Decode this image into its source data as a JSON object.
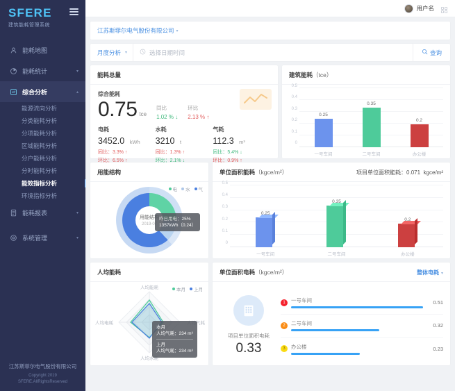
{
  "sidebar": {
    "logo": "SFERE",
    "subtitle": "建筑能耗管理系统",
    "menu": [
      {
        "label": "能耗地图",
        "icon": "map-icon",
        "expandable": false
      },
      {
        "label": "能耗统计",
        "icon": "pie-icon",
        "expandable": true
      },
      {
        "label": "综合分析",
        "icon": "analysis-icon",
        "expandable": true,
        "active": true
      }
    ],
    "submenu": [
      {
        "label": "能源流向分析"
      },
      {
        "label": "分类能耗分析"
      },
      {
        "label": "分项能耗分析"
      },
      {
        "label": "区域能耗分析"
      },
      {
        "label": "分户能耗分析"
      },
      {
        "label": "分时能耗分析"
      },
      {
        "label": "能效指标分析",
        "selected": true
      },
      {
        "label": "环境指标分析"
      }
    ],
    "menu_bottom": [
      {
        "label": "能耗报表",
        "icon": "report-icon",
        "expandable": true
      },
      {
        "label": "系统管理",
        "icon": "gear-icon",
        "expandable": true
      }
    ],
    "footer": {
      "company": "江苏斯菲尔电气股份有限公司",
      "copyright": "Copyright 2019",
      "rights": "SFERE.AllRightsReserved"
    }
  },
  "topbar": {
    "user_name": "用户名"
  },
  "org": {
    "name": "江苏斯菲尔电气股份有限公司"
  },
  "filter": {
    "period": "月度分析",
    "date_placeholder": "选择日期时间",
    "search_label": "查询"
  },
  "summary": {
    "title": "能耗总量",
    "comprehensive_label": "综合能耗",
    "value": "0.75",
    "unit": "tce",
    "yoy_label": "同比",
    "yoy_value": "1.02 %",
    "yoy_dir": "down",
    "mom_label": "环比",
    "mom_value": "2.13 %",
    "mom_dir": "up",
    "metrics": [
      {
        "name": "电耗",
        "value": "3452.0",
        "unit": "kWh",
        "yoy": "同比：3.3%",
        "yoy_dir": "up",
        "mom": "环比：6.5%",
        "mom_dir": "up"
      },
      {
        "name": "水耗",
        "value": "3210",
        "unit": "t",
        "yoy": "同比：1.3%",
        "yoy_dir": "up",
        "mom": "环比：2.1%",
        "mom_dir": "down"
      },
      {
        "name": "气耗",
        "value": "112.3",
        "unit": "m³",
        "yoy": "同比：5.4%",
        "yoy_dir": "down",
        "mom": "环比：0.9%",
        "mom_dir": "up"
      }
    ]
  },
  "building_card": {
    "title": "建筑能耗",
    "unit": "（tce）"
  },
  "structure_card": {
    "title": "用能结构",
    "legend": [
      {
        "label": "电",
        "color": "#4ecb9a"
      },
      {
        "label": "水",
        "color": "#aec7e8"
      },
      {
        "label": "气",
        "color": "#4a7fe0"
      }
    ],
    "center_title": "用能结构",
    "center_date": "2019-07",
    "tooltip": {
      "line1": "昨日用电：",
      "percent": "25%",
      "line2": "1357kWh（0.24）"
    }
  },
  "unit_area_card": {
    "title": "单位面积能耗",
    "unit": "（kgce/m²）",
    "project_label": "项目单位面积能耗：",
    "project_value": "0.071",
    "project_unit": "kgce/m²"
  },
  "per_capita_card": {
    "title": "人均能耗",
    "legend": [
      {
        "label": "本月",
        "color": "#4ecb9a"
      },
      {
        "label": "上月",
        "color": "#4a7fe0"
      }
    ],
    "axes": [
      "人均能耗",
      "人均气耗",
      "人均水耗",
      "人均电耗"
    ],
    "tooltip": {
      "g1_title": "本月",
      "g1_row": "人均气耗：234 m³",
      "g2_title": "上月",
      "g2_row": "人均气耗：234 m³"
    }
  },
  "elec_rank_card": {
    "title": "单位面积电耗",
    "unit": "（kgce/m²）",
    "selector": "整体电耗",
    "project_label": "项目单位面积电耗",
    "project_value": "0.33",
    "rows": [
      {
        "rank": "1",
        "name": "一号车间",
        "value": "0.51",
        "pct": 100,
        "color": "#f5222d"
      },
      {
        "rank": "2",
        "name": "二号车间",
        "value": "0.32",
        "pct": 67,
        "color": "#fa8c16"
      },
      {
        "rank": "3",
        "name": "办公楼",
        "value": "0.23",
        "pct": 52,
        "color": "#fadb14"
      }
    ]
  },
  "chart_data": [
    {
      "type": "bar",
      "title": "建筑能耗 (tce)",
      "categories": [
        "一号车间",
        "二号车间",
        "办公楼"
      ],
      "values": [
        0.25,
        0.35,
        0.2
      ],
      "colors": [
        "#6c93ed",
        "#4ecb9a",
        "#cc4040"
      ],
      "ylabel": "tce",
      "ylim": [
        0,
        0.5
      ],
      "yticks": [
        0,
        0.1,
        0.2,
        0.3,
        0.4,
        0.5
      ],
      "ytick_labels": [
        "0",
        "0.1",
        "0.2",
        "0.3",
        "0.4",
        "0.5"
      ],
      "data_labels": [
        "0.25",
        "0.35",
        "0.2"
      ],
      "grid": true,
      "legend": false
    },
    {
      "type": "bar",
      "title": "单位面积能耗 (kgce/m²)",
      "categories": [
        "一号车间",
        "二号车间",
        "办公楼"
      ],
      "values": [
        0.25,
        0.35,
        0.2
      ],
      "colors": [
        "#6c93ed",
        "#4ecb9a",
        "#cc4040"
      ],
      "ylabel": "kgce/m²",
      "ylim": [
        0,
        0.5
      ],
      "yticks": [
        0,
        0.1,
        0.2,
        0.3,
        0.4,
        0.5
      ],
      "ytick_labels": [
        "0",
        "0.1",
        "0.2",
        "0.3",
        "0.4",
        "0.5"
      ],
      "data_labels": [
        "0.25",
        "0.35",
        "0.2"
      ],
      "grid": true,
      "legend": false,
      "annotation": "项目单位面积能耗：0.071 kgce/m²"
    },
    {
      "type": "pie",
      "title": "用能结构",
      "labels": [
        "电",
        "水",
        "气"
      ],
      "values": [
        25,
        13,
        62
      ],
      "colors": [
        "#4ecb9a",
        "#aec7e8",
        "#4a7fe0"
      ],
      "center_label": "用能结构 2019-07",
      "legend": true
    },
    {
      "type": "line",
      "subtype": "radar",
      "title": "人均能耗",
      "axes": [
        "人均能耗",
        "人均气耗",
        "人均水耗",
        "人均电耗"
      ],
      "series": [
        {
          "name": "本月",
          "values": [
            0.72,
            0.45,
            0.5,
            0.62
          ],
          "color": "#4ecb9a"
        },
        {
          "name": "上月",
          "values": [
            0.62,
            0.42,
            0.52,
            0.58
          ],
          "color": "#4a7fe0"
        }
      ],
      "legend": true
    },
    {
      "type": "bar",
      "subtype": "horizontal-rank",
      "title": "单位面积电耗 (kgce/m²)",
      "categories": [
        "一号车间",
        "二号车间",
        "办公楼"
      ],
      "values": [
        0.51,
        0.32,
        0.23
      ],
      "bar_color": "#37a2f5",
      "legend": false
    }
  ]
}
